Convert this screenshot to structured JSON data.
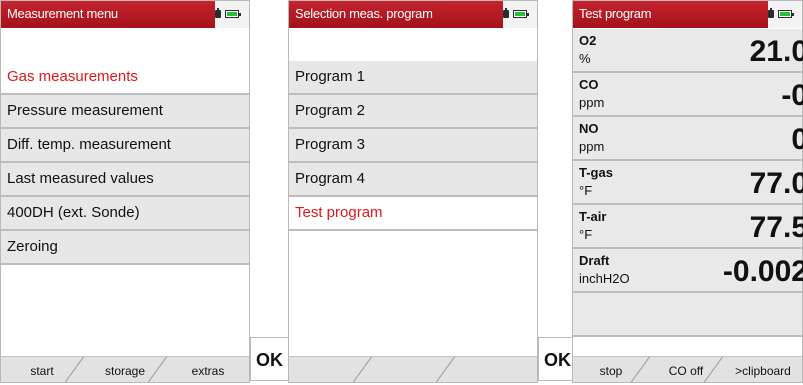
{
  "screens": [
    {
      "title": "Measurement menu",
      "items": [
        "Gas measurements",
        "Pressure measurement",
        "Diff. temp. measurement",
        "Last measured values",
        "400DH (ext. Sonde)",
        "Zeroing"
      ],
      "selected_index": 0,
      "softkeys": [
        "start",
        "storage",
        "extras"
      ]
    },
    {
      "title": "Selection meas. program",
      "items": [
        "Program 1",
        "Program 2",
        "Program 3",
        "Program 4",
        "Test program"
      ],
      "selected_index": 4,
      "softkeys": [
        "",
        "",
        ""
      ]
    },
    {
      "title": "Test program",
      "rows": [
        {
          "name": "O2",
          "unit": "%",
          "value": "21.0"
        },
        {
          "name": "CO",
          "unit": "ppm",
          "value": "-0"
        },
        {
          "name": "NO",
          "unit": "ppm",
          "value": "0"
        },
        {
          "name": "T-gas",
          "unit": "°F",
          "value": "77.0"
        },
        {
          "name": "T-air",
          "unit": "°F",
          "value": "77.5"
        },
        {
          "name": "Draft",
          "unit": "inchH2O",
          "value": "-0.002"
        }
      ],
      "softkeys": [
        "stop",
        "CO off",
        ">clipboard"
      ]
    }
  ],
  "ok_buttons": [
    "OK",
    "OK"
  ],
  "status_icons": [
    "power-plug-icon",
    "battery-icon"
  ],
  "colors": {
    "title_bar": "#b81a24",
    "selected_text": "#e0171c",
    "battery_fill": "#23c23a"
  }
}
